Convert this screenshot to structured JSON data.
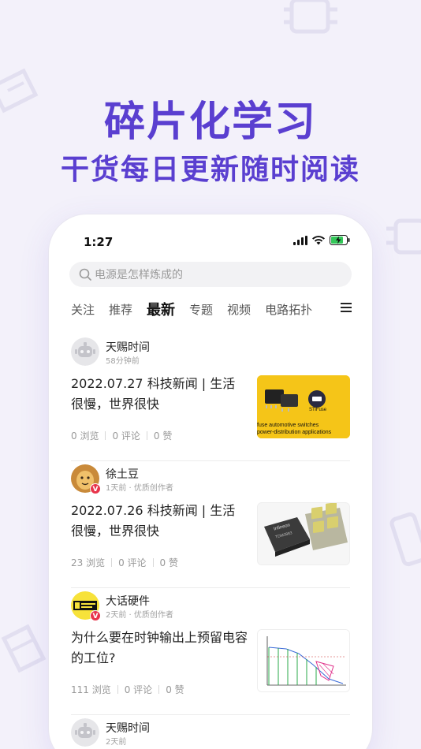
{
  "promo": {
    "title": "碎片化学习",
    "subtitle": "干货每日更新随时阅读"
  },
  "status_bar": {
    "time": "1:27"
  },
  "search": {
    "placeholder": "电源是怎样炼成的"
  },
  "tabs": [
    {
      "label": "关注",
      "active": false
    },
    {
      "label": "推荐",
      "active": false
    },
    {
      "label": "最新",
      "active": true
    },
    {
      "label": "专题",
      "active": false
    },
    {
      "label": "视频",
      "active": false
    },
    {
      "label": "电路拓扑",
      "active": false
    }
  ],
  "feed": [
    {
      "author": "天赐时间",
      "meta": "58分钟前",
      "verified": false,
      "title": "2022.07.27 科技新闻 | 生活很慢，世界很快",
      "views": "0 浏览",
      "comments": "0 评论",
      "likes": "0 赞",
      "thumb_caption_1": "fuse automotive switches",
      "thumb_caption_2": "power-distribution applications",
      "thumb_badge": "STiFuse"
    },
    {
      "author": "徐土豆",
      "meta": "1天前 · 优质创作者",
      "verified": true,
      "title": "2022.07.26 科技新闻 | 生活很慢，世界很快",
      "views": "23 浏览",
      "comments": "0 评论",
      "likes": "0 赞",
      "thumb_chip_brand": "Infineon",
      "thumb_chip_code": "TDM3883"
    },
    {
      "author": "大话硬件",
      "meta": "2天前 · 优质创作者",
      "verified": true,
      "title": "为什么要在时钟输出上预留电容的工位?",
      "views": "111 浏览",
      "comments": "0 评论",
      "likes": "0 赞"
    },
    {
      "author": "天赐时间",
      "meta": "2天前",
      "verified": false
    }
  ],
  "colors": {
    "accent": "#5a3fd0",
    "verified": "#e8344b",
    "thumb_yellow": "#f5c518"
  },
  "icons": [
    "search-icon",
    "signal-icon",
    "wifi-icon",
    "battery-charging-icon",
    "menu-icon",
    "robot-avatar-icon"
  ]
}
